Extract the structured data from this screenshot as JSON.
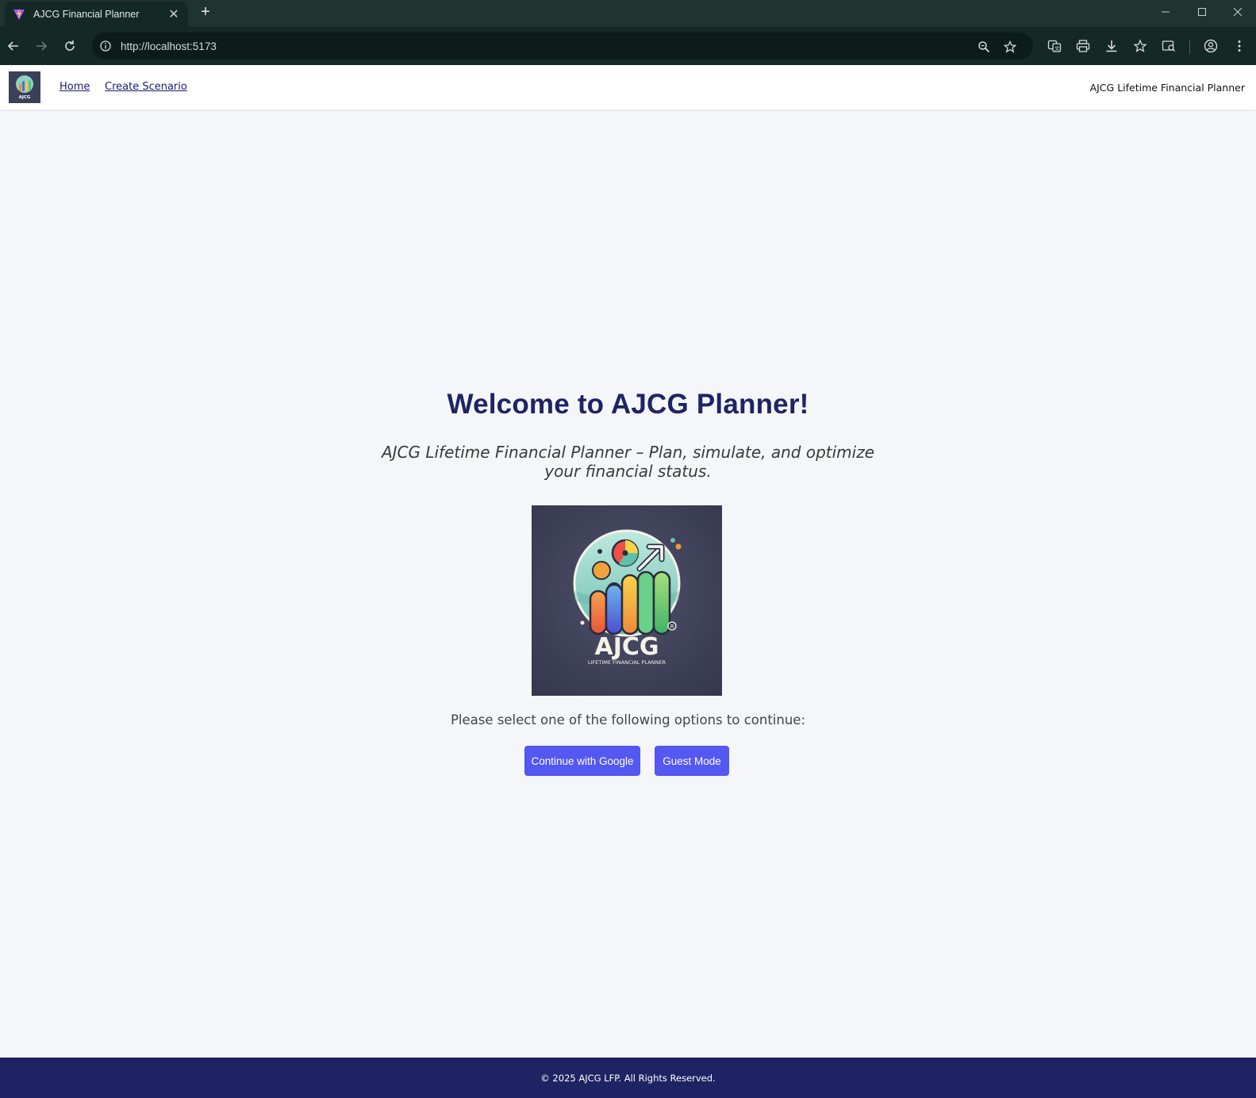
{
  "browser": {
    "tab_title": "AJCG Financial Planner",
    "url": "http://localhost:5173"
  },
  "nav": {
    "logo_text": "AJCG",
    "links": [
      "Home",
      "Create Scenario"
    ],
    "brand": "AJCG Lifetime Financial Planner"
  },
  "main": {
    "heading": "Welcome to AJCG Planner!",
    "subtitle": "AJCG Lifetime Financial Planner – Plan, simulate, and optimize your financial status.",
    "logo_title": "AJCG",
    "logo_tagline": "LIFETIME FINANCIAL PLANNER",
    "prompt": "Please select one of the following options to continue:",
    "buttons": {
      "google": "Continue with Google",
      "guest": "Guest Mode"
    }
  },
  "footer": {
    "text": "© 2025 AJCG LFP. All Rights Reserved."
  },
  "colors": {
    "accent": "#5457f0",
    "navy": "#1e2463",
    "background": "#f4f6fa"
  }
}
